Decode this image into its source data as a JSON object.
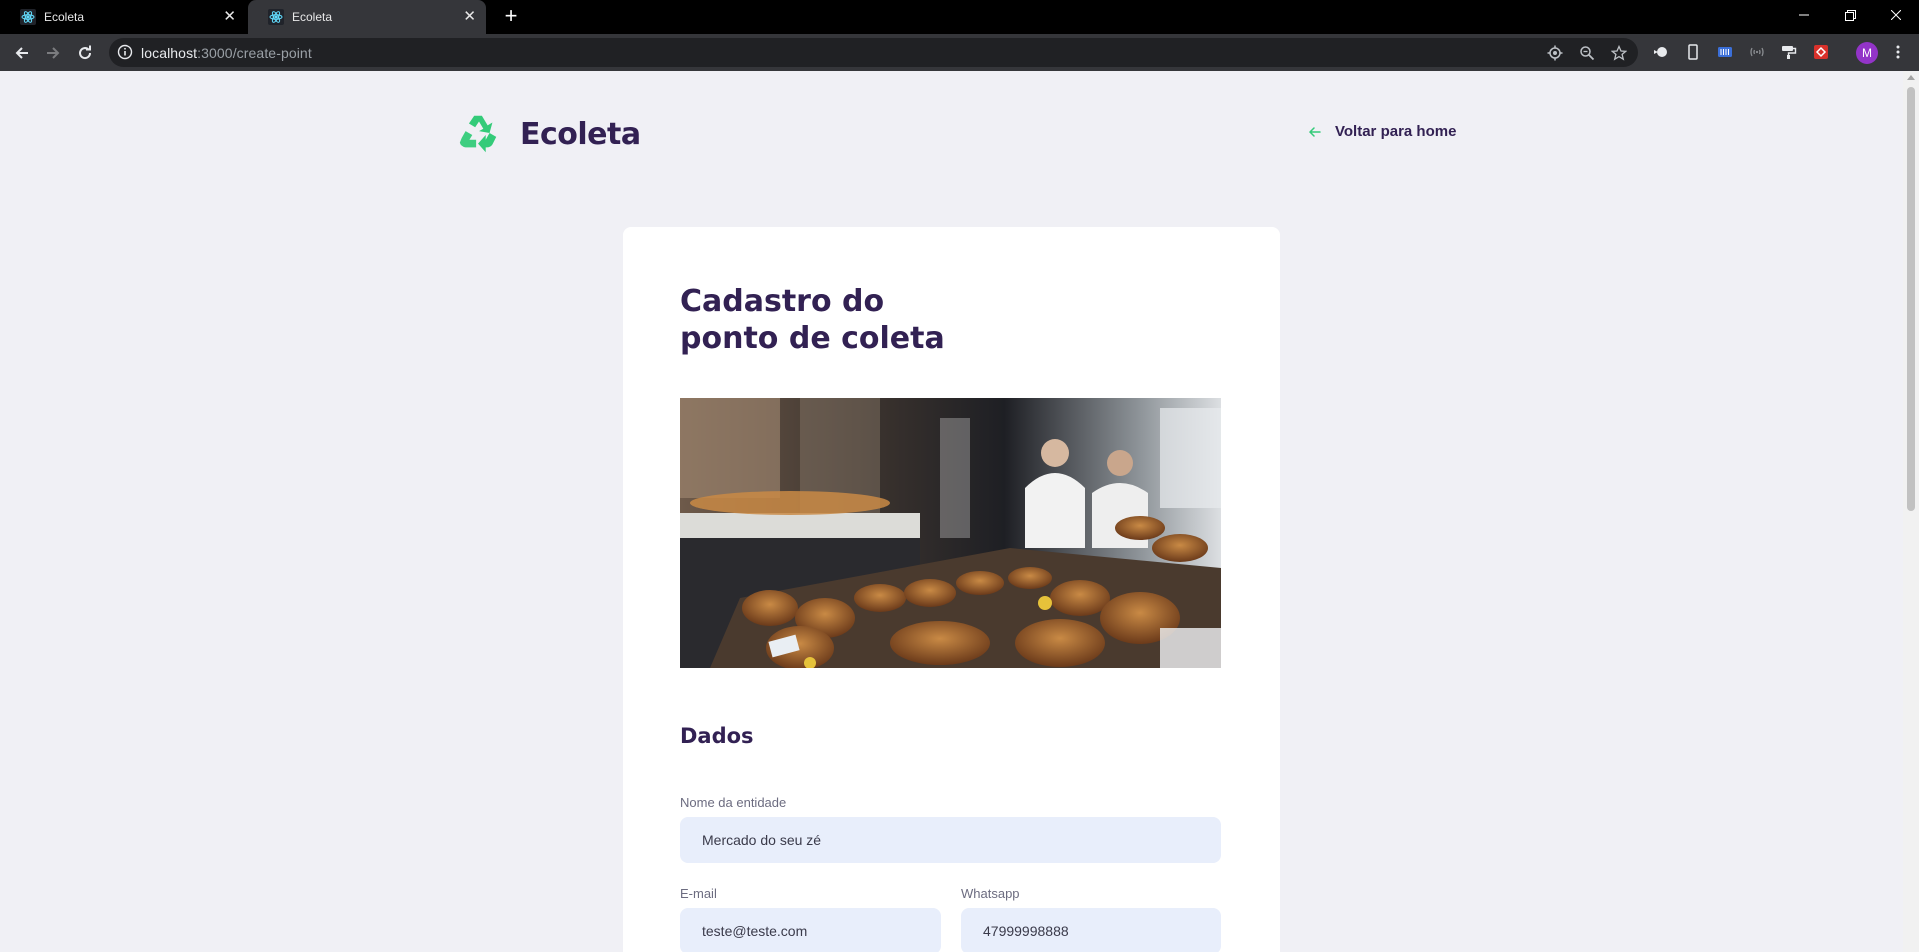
{
  "browser": {
    "tabs": [
      {
        "title": "Ecoleta",
        "active": false
      },
      {
        "title": "Ecoleta",
        "active": true
      }
    ],
    "url_host": "localhost",
    "url_path": ":3000/create-point",
    "profile_initial": "M"
  },
  "header": {
    "logo_text": "Ecoleta",
    "back_link": "Voltar para home"
  },
  "form": {
    "title_line1": "Cadastro do",
    "title_line2": "ponto de coleta",
    "section_title": "Dados",
    "name_label": "Nome da entidade",
    "name_value": "Mercado do seu zé",
    "email_label": "E-mail",
    "email_value": "teste@teste.com",
    "whatsapp_label": "Whatsapp",
    "whatsapp_value": "47999998888"
  },
  "colors": {
    "brand": "#322153",
    "accent": "#34cb79",
    "input_bg": "#e8eefb",
    "page_bg": "#f0f0f5"
  }
}
